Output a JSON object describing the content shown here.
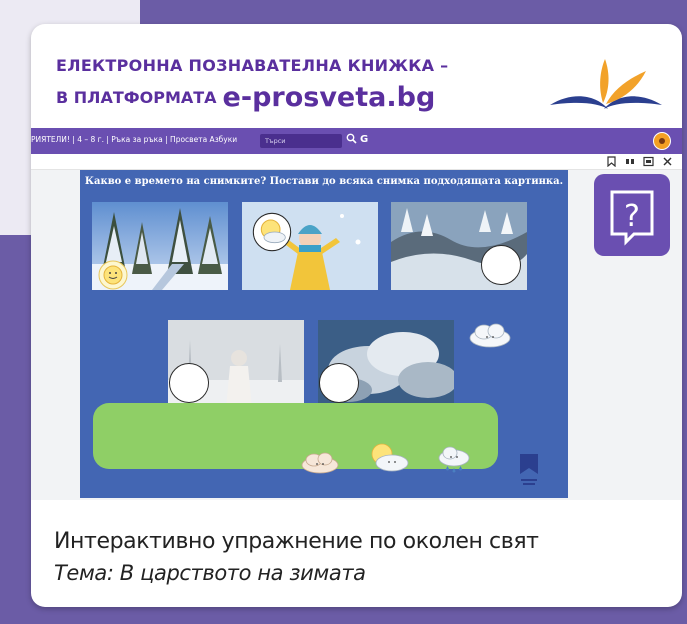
{
  "header": {
    "line1": "ЕЛЕКТРОННА ПОЗНАВАТЕЛНА КНИЖКА –",
    "line2_prefix": "В ПЛАТФОРМАТА",
    "line2_brand": "e-prosveta.bg"
  },
  "browser": {
    "breadcrumb": "РИЯТЕЛИ! | 4 – 8 г. | Ръка за ръка | Просвета Азбуки",
    "search_placeholder": "Търси",
    "g_label": "G"
  },
  "viewer_toolbar": {
    "icons": [
      "bookmark-icon",
      "columns-icon",
      "window-icon",
      "close-icon"
    ]
  },
  "slide": {
    "title": "Какво е времето на снимките? Постави до всяка снимка подходящата картинка."
  },
  "help_button": {
    "label": "?"
  },
  "caption": {
    "line1": "Интерактивно упражнение по околен свят",
    "line2": "Тема: В царството на зимата"
  },
  "colors": {
    "page_bg": "#6b5ca6",
    "brand_purple": "#5a2f9e",
    "browser_bar": "#6a4fb1",
    "slide_blue": "#4366b3",
    "green_tray": "#8fcf66"
  }
}
